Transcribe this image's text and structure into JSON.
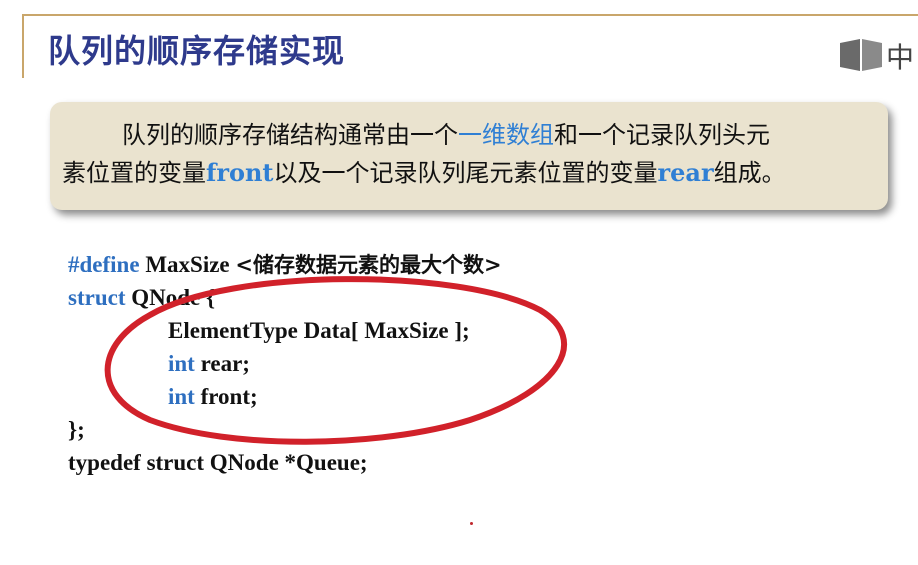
{
  "title": "队列的顺序存储实现",
  "logo": {
    "icon": "book-icon",
    "char": "中"
  },
  "intro": {
    "line1_part1": "队列的顺序存储结构通常由一个",
    "line1_highlight": "一维数组",
    "line1_part2": "和一个记录队列头元",
    "line2_part1": "素位置的变量",
    "line2_front": "front",
    "line2_part2": "以及一个记录队列尾元素位置的变量",
    "line2_rear": "rear",
    "line2_part3": "组成。"
  },
  "code": {
    "define_kw": "#define",
    "define_name": "MaxSize",
    "define_value": "<储存数据元素的最大个数>",
    "struct_kw": "struct",
    "struct_name": "QNode {",
    "field1": "ElementType  Data[ MaxSize ];",
    "field2_type": "int",
    "field2_name": "rear;",
    "field3_type": "int",
    "field3_name": "front;",
    "close": "};",
    "typedef": "typedef struct QNode *Queue;"
  },
  "colors": {
    "title": "#2e3a8c",
    "highlight": "#2f7fd4",
    "keyword": "#2e6fc0",
    "annotation": "#d1212a",
    "box": "#eae3cf"
  }
}
